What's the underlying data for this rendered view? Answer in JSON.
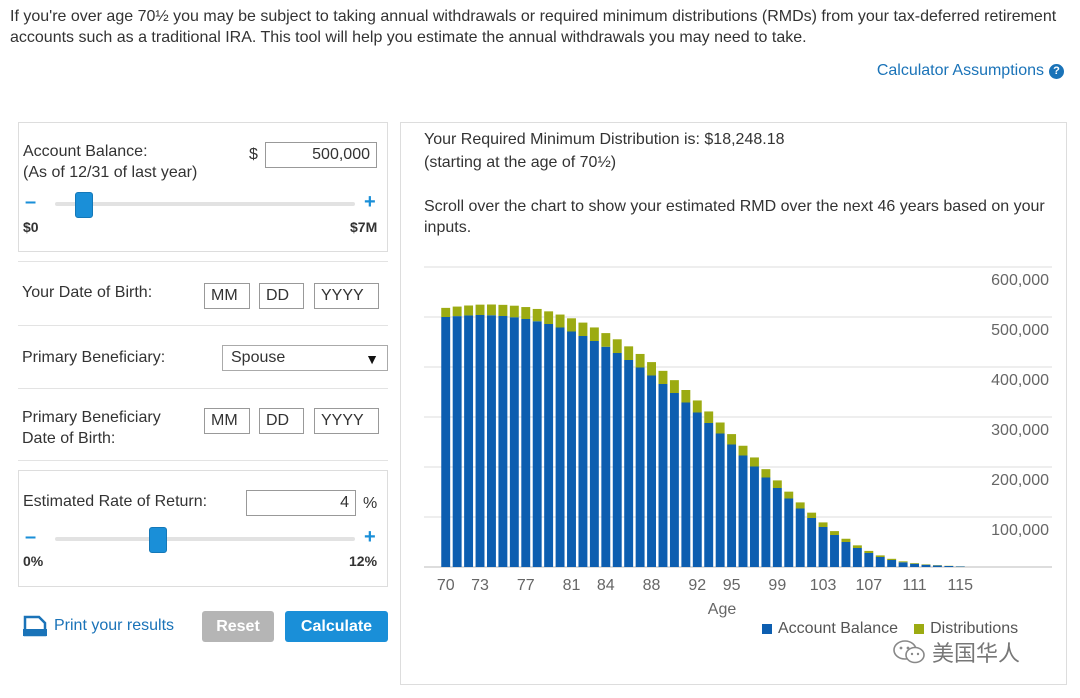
{
  "intro": "If you're over age 70½ you may be subject to taking annual withdrawals or required minimum distributions (RMDs) from your tax-deferred retirement accounts such as a traditional IRA. This tool will help you estimate the annual withdrawals you may need to take.",
  "assumptions_link": "Calculator Assumptions",
  "form": {
    "balance_label_1": "Account Balance:",
    "balance_label_2": "(As of 12/31 of last year)",
    "currency": "$",
    "balance_value": "500,000",
    "balance_min": "$0",
    "balance_max": "$7M",
    "balance_fraction": 0.071,
    "dob_label": "Your Date of Birth:",
    "mm": "MM",
    "dd": "DD",
    "yyyy": "YYYY",
    "beneficiary_label": "Primary Beneficiary:",
    "beneficiary_value": "Spouse",
    "ben_dob_label_1": "Primary Beneficiary",
    "ben_dob_label_2": "Date of Birth:",
    "rate_label": "Estimated Rate of Return:",
    "rate_value": "4",
    "percent": "%",
    "rate_min": "0%",
    "rate_max": "12%",
    "rate_fraction": 0.333,
    "minus": "–",
    "plus": "+"
  },
  "actions": {
    "print": "Print your results",
    "reset": "Reset",
    "calculate": "Calculate"
  },
  "result": {
    "line1": "Your Required Minimum Distribution is: $18,248.18",
    "line2": "(starting at the age of 70½)",
    "scroll": "Scroll over the chart to show your estimated RMD over the next 46 years based on your inputs."
  },
  "colors": {
    "balance": "#0d5eb0",
    "distribution": "#9cab12",
    "accent": "#1a8fd8",
    "reset": "#b5b5b5",
    "link": "#1a73b8"
  },
  "watermark": "美国华人",
  "chart_data": {
    "type": "bar",
    "stacked": true,
    "xlabel": "Age",
    "ylim": [
      0,
      600000
    ],
    "y_ticks": [
      "100,000",
      "200,000",
      "300,000",
      "400,000",
      "500,000",
      "600,000"
    ],
    "y_tick_values": [
      100000,
      200000,
      300000,
      400000,
      500000,
      600000
    ],
    "x_tick_labels": [
      "70",
      "73",
      "77",
      "81",
      "84",
      "88",
      "92",
      "95",
      "99",
      "103",
      "107",
      "111",
      "115"
    ],
    "x": [
      70,
      71,
      72,
      73,
      74,
      75,
      76,
      77,
      78,
      79,
      80,
      81,
      82,
      83,
      84,
      85,
      86,
      87,
      88,
      89,
      90,
      91,
      92,
      93,
      94,
      95,
      96,
      97,
      98,
      99,
      100,
      101,
      102,
      103,
      104,
      105,
      106,
      107,
      108,
      109,
      110,
      111,
      112,
      113,
      114,
      115
    ],
    "series": [
      {
        "name": "Account Balance",
        "color": "#0d5eb0",
        "values": [
          500000,
          501750,
          503100,
          504000,
          503500,
          502000,
          499500,
          496000,
          491500,
          486000,
          479000,
          471000,
          462000,
          452000,
          440500,
          428000,
          414000,
          399000,
          383000,
          366000,
          348000,
          329000,
          309000,
          288000,
          267000,
          245000,
          223000,
          201000,
          179000,
          158000,
          137000,
          117000,
          98000,
          80000,
          64000,
          50000,
          38000,
          28000,
          20000,
          14000,
          9500,
          6500,
          4500,
          3000,
          2000,
          1000
        ]
      },
      {
        "name": "Distributions",
        "color": "#9cab12",
        "values": [
          18248,
          19100,
          19900,
          20700,
          21500,
          22300,
          23100,
          23900,
          24600,
          25300,
          25900,
          26400,
          26800,
          27100,
          27300,
          27400,
          27300,
          27100,
          26800,
          26300,
          25700,
          25000,
          24100,
          23100,
          22000,
          20800,
          19500,
          18100,
          16700,
          15200,
          13700,
          12200,
          10700,
          9200,
          7800,
          6500,
          5300,
          4200,
          3200,
          2400,
          1800,
          1300,
          900,
          600,
          400,
          250
        ]
      }
    ],
    "legend_placement": "bottom-right"
  }
}
